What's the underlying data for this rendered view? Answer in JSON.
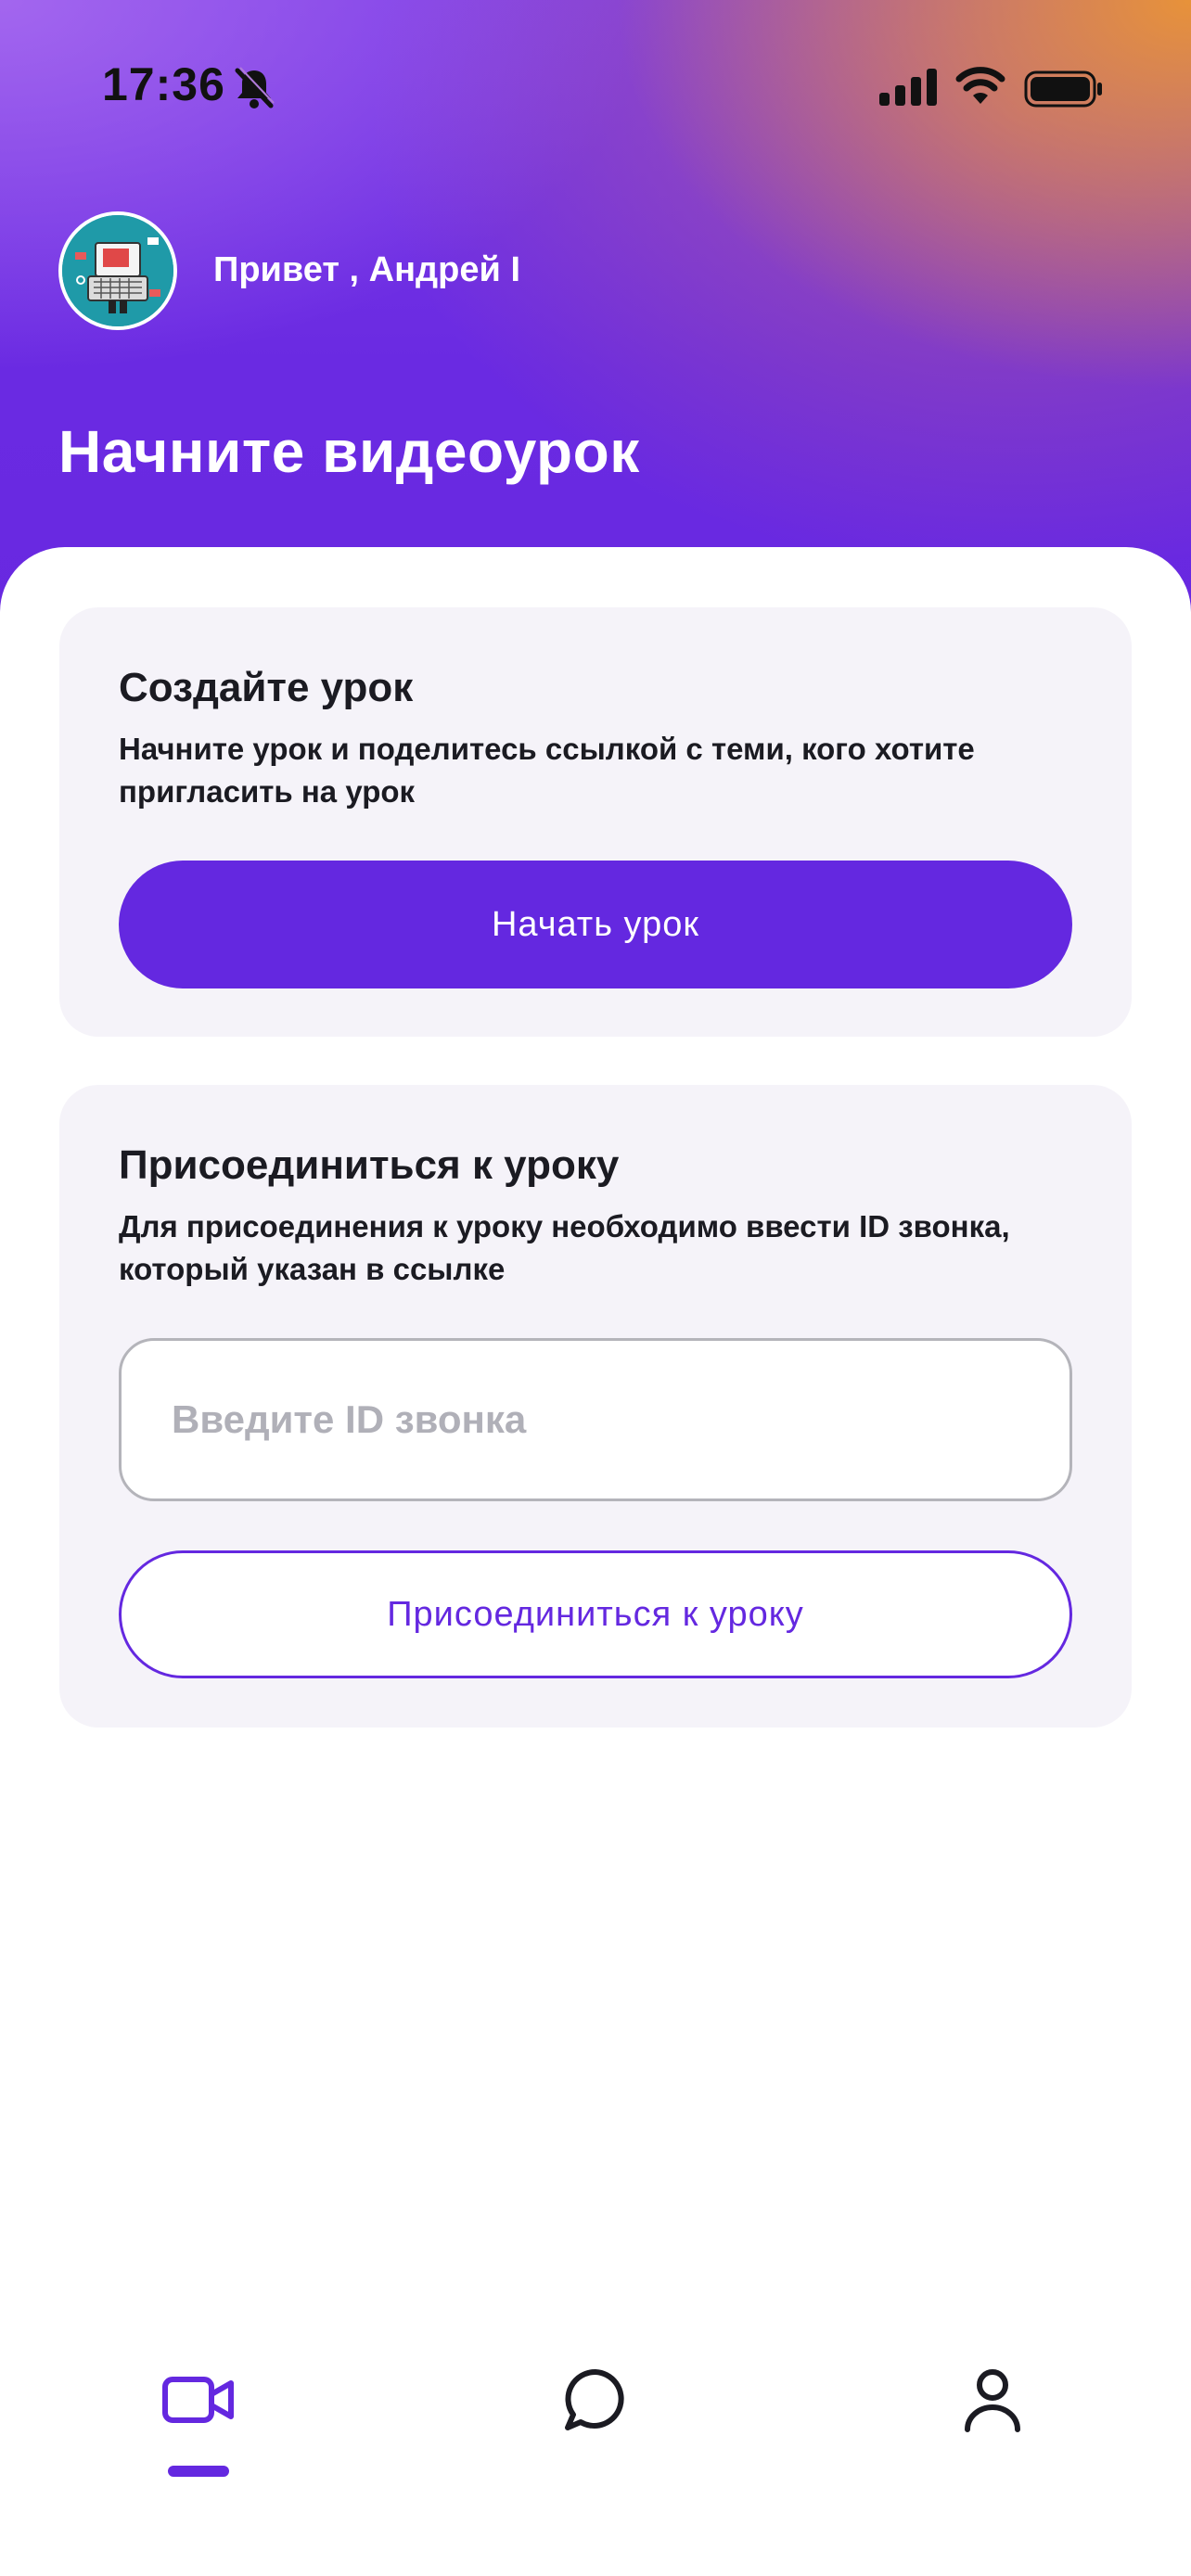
{
  "status_bar": {
    "time": "17:36",
    "icons": [
      "bell-slash-icon",
      "signal-icon",
      "wifi-icon",
      "battery-icon"
    ]
  },
  "header": {
    "greeting": "Привет , Андрей I",
    "title": "Начните видеоурок",
    "gradient_colors": [
      "#7a3ae6",
      "#6a2ae2",
      "#e99634"
    ]
  },
  "create_card": {
    "title": "Создайте урок",
    "description": "Начните урок и поделитесь ссылкой с теми, кого хотите пригласить на урок",
    "button_label": "Начать урок"
  },
  "join_card": {
    "title": "Присоединиться к уроку",
    "description": "Для присоединения к уроку необходимо ввести ID звонка, который указан в ссылке",
    "input_value": "",
    "input_placeholder": "Введите ID звонка",
    "button_label": "Присоединиться к уроку"
  },
  "tab_bar": {
    "tabs": [
      {
        "icon": "video-camera-icon",
        "active": true
      },
      {
        "icon": "chat-bubble-icon",
        "active": false
      },
      {
        "icon": "user-icon",
        "active": false
      }
    ]
  },
  "colors": {
    "accent": "#6428e0",
    "card_bg": "#f5f3f9",
    "text": "#1b1b22",
    "placeholder": "#b0b0b8"
  }
}
